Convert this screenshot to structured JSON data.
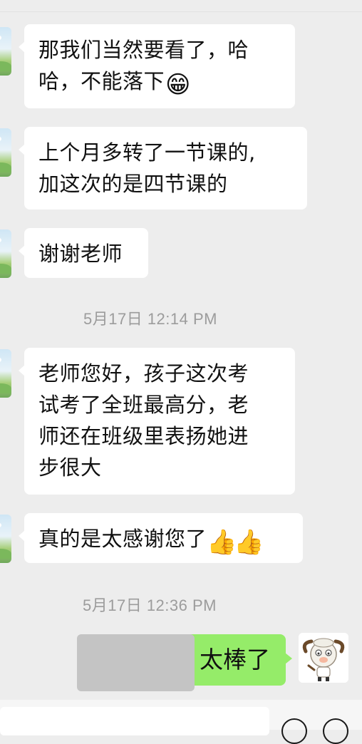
{
  "messages": [
    {
      "id": "m1",
      "text_line1": "那我们当然要看了，哈",
      "text_line2": "哈，不能落下",
      "emoji": "😁",
      "emoji_name": "grinning-face-icon"
    },
    {
      "id": "m2",
      "text_line1": "上个月多转了一节课的,",
      "text_line2": "加这次的是四节课的"
    },
    {
      "id": "m3",
      "text_line1": "谢谢老师"
    },
    {
      "id": "m4",
      "text_line1": "老师您好，孩子这次考",
      "text_line2": "试考了全班最高分，老",
      "text_line3": "师还在班级里表扬她进",
      "text_line4": "步很大"
    },
    {
      "id": "m5",
      "text_line1": "真的是太感谢您了",
      "emoji1": "👍",
      "emoji2": "👍"
    }
  ],
  "timestamps": [
    "5月17日 12:14 PM",
    "5月17日 12:36 PM"
  ],
  "reply": {
    "text": "太棒了"
  },
  "colors": {
    "background": "#ededed",
    "incoming_bubble": "#ffffff",
    "outgoing_bubble": "#95ec69",
    "timestamp": "#9c9c9c"
  }
}
